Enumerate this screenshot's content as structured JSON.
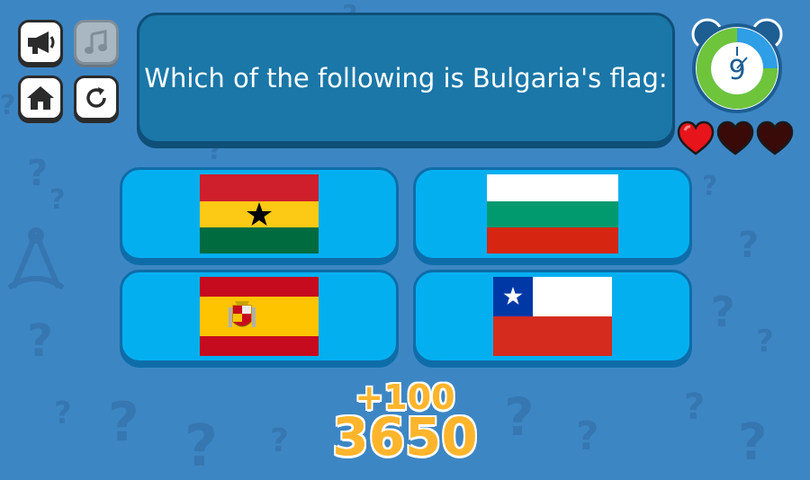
{
  "question": {
    "text": "Which of the following is Bulgaria's flag:"
  },
  "controls": {
    "sound_icon": "megaphone-icon",
    "music_icon": "music-note-icon",
    "home_icon": "home-icon",
    "restart_icon": "restart-icon"
  },
  "timer": {
    "value": "9",
    "remaining_fraction": 0.75
  },
  "lives": {
    "total": 3,
    "remaining": 1
  },
  "answers": [
    {
      "country_flag": "Ghana",
      "position": "top-left"
    },
    {
      "country_flag": "Bulgaria",
      "position": "top-right"
    },
    {
      "country_flag": "Spain",
      "position": "bottom-left"
    },
    {
      "country_flag": "Chile",
      "position": "bottom-right"
    }
  ],
  "score": {
    "bonus": "+100",
    "total": "3650"
  },
  "colors": {
    "background": "#3d86c4",
    "panel": "#1a77a8",
    "answer": "#04aff0",
    "score": "#ffb52b",
    "heart_full": "#e8141b",
    "heart_empty": "#3a0a08"
  }
}
